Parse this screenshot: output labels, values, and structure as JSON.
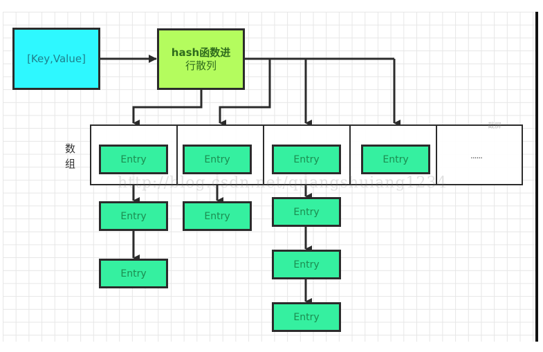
{
  "diagram": {
    "key_value_label": "[Key,Value]",
    "hash_label_line1": "hash函数进",
    "hash_label_line2": "行散列",
    "array_label": "数组",
    "entry_label": "Entry",
    "ellipsis_label": "......",
    "watermark": "http://blog.csdn.net/quangshuiang1234",
    "screenshot_tag": "截屏",
    "buckets": [
      {
        "index": 0,
        "chain_length": 3
      },
      {
        "index": 1,
        "chain_length": 2
      },
      {
        "index": 2,
        "chain_length": 4
      },
      {
        "index": 3,
        "chain_length": 1
      },
      {
        "index": 4,
        "chain_length": 0,
        "placeholder": true
      }
    ],
    "colors": {
      "key_value_fill": "#2ef8ff",
      "hash_fill": "#b4fc5e",
      "entry_fill": "#35f0a0",
      "stroke": "#2b2b2b"
    }
  }
}
